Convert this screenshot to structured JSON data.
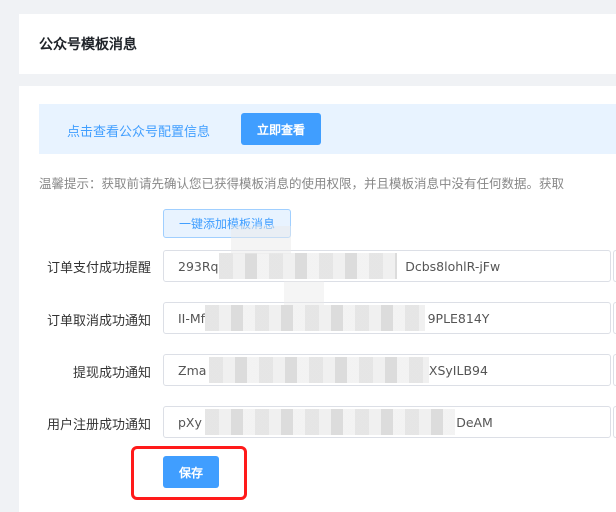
{
  "header": {
    "title": "公众号模板消息"
  },
  "banner": {
    "text": "点击查看公众号配置信息",
    "button_label": "立即查看"
  },
  "tip": "温馨提示：获取前请先确认您已获得模板消息的使用权限，并且模板消息中没有任何数据。获取",
  "add_button_label": "一键添加模板消息",
  "rows": [
    {
      "label": "订单支付成功提醒",
      "value": "293Rq                                               Dcbs8lohlR-jFw"
    },
    {
      "label": "订单取消成功通知",
      "value": "II-Mf                                                        9PLE814Y"
    },
    {
      "label": "提现成功通知",
      "value": "Zma                                                        XSyILB94"
    },
    {
      "label": "用户注册成功通知",
      "value": "pXy                                                                DeAM"
    }
  ],
  "save_label": "保存",
  "colors": {
    "primary": "#409eff",
    "highlight": "#ff1a1a",
    "banner_bg": "#e8f3ff"
  }
}
